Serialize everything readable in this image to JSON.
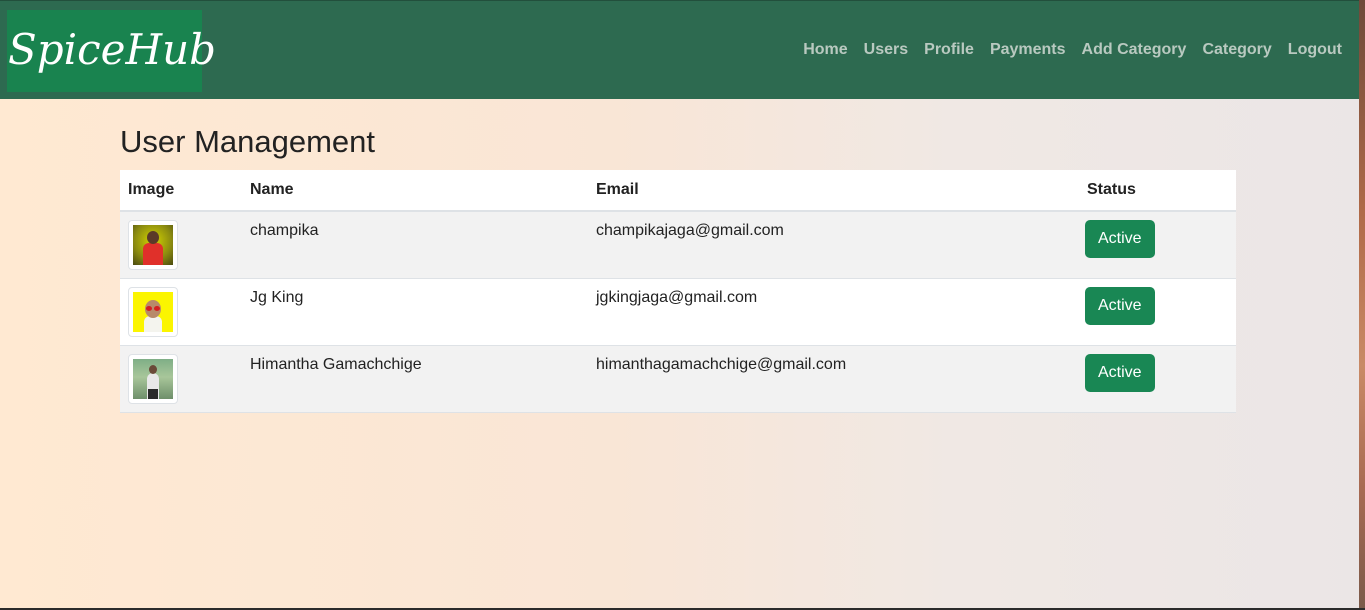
{
  "brand": {
    "name": "SpiceHub"
  },
  "nav": {
    "items": [
      "Home",
      "Users",
      "Profile",
      "Payments",
      "Add Category",
      "Category",
      "Logout"
    ]
  },
  "page": {
    "title": "User Management"
  },
  "table": {
    "headers": {
      "image": "Image",
      "name": "Name",
      "email": "Email",
      "status": "Status"
    },
    "rows": [
      {
        "name": "champika",
        "email": "champikajaga@gmail.com",
        "status": "Active",
        "image_icon": "user-photo"
      },
      {
        "name": "Jg King",
        "email": "jgkingjaga@gmail.com",
        "status": "Active",
        "image_icon": "user-photo"
      },
      {
        "name": "Himantha Gamachchige",
        "email": "himanthagamachchige@gmail.com",
        "status": "Active",
        "image_icon": "user-photo"
      }
    ]
  },
  "colors": {
    "navbar": "#2d6a50",
    "brand_bg": "#19834f",
    "status_active": "#198754",
    "nav_link": "#b9c9c0"
  }
}
